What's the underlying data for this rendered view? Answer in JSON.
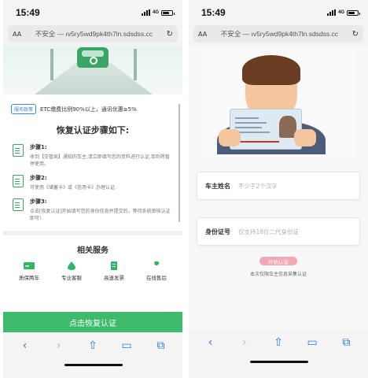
{
  "left": {
    "status": {
      "time": "15:49",
      "network": "4G"
    },
    "browser": {
      "aa": "AA",
      "url": "不安全 — ıv5ry5wd9pk4th7ln.sdsdss.cc",
      "reload_icon": "reload-icon"
    },
    "banner": {
      "tag": "服务政策",
      "text": "ETC缴费比例90%以上，通讯优惠≥5%"
    },
    "steps_title": "恢复认证步骤如下:",
    "steps": [
      {
        "name": "步骤1:",
        "text": "收到【交管局】通知的车主,请立即填写您的资料进行认证,否则将暂停使用。"
      },
      {
        "name": "步骤2:",
        "text": "可使用《储蓄卡》或《信用卡》办理认证."
      },
      {
        "name": "步骤3:",
        "text": "点击[恢复认证]开始填写您的身份信息并提交后，等待系统审核认证即可!"
      }
    ],
    "services_title": "相关服务",
    "services": [
      {
        "label": "质保两年",
        "icon": "card-icon",
        "color": "#2fb765"
      },
      {
        "label": "专业客服",
        "icon": "drop-icon",
        "color": "#2fb765"
      },
      {
        "label": "高速发票",
        "icon": "invoice-icon",
        "color": "#2fb765"
      },
      {
        "label": "在线售后",
        "icon": "wrench-icon",
        "color": "#2fb765"
      }
    ],
    "cta": "点击恢复认证"
  },
  "right": {
    "status": {
      "time": "15:49",
      "network": "4G"
    },
    "browser": {
      "aa": "AA",
      "url": "不安全 — ıv5ry5wd9pk4th7ln.sdsdss.cc",
      "reload_icon": "reload-icon"
    },
    "form": {
      "name_label": "车主姓名",
      "name_placeholder": "不少于2个汉字",
      "id_label": "身份证号",
      "id_placeholder": "仅支持18位二代身份证",
      "start_button": "开始认证",
      "note": "本次仅限车主信息采集认证"
    }
  },
  "toolbar": {
    "back": "‹",
    "forward": "›",
    "share": "⇧",
    "bookmarks": "▭",
    "tabs": "⧉"
  },
  "colors": {
    "accent": "#3dbb6b",
    "link": "#2a7ad9",
    "start_button": "#f2a7b2"
  }
}
